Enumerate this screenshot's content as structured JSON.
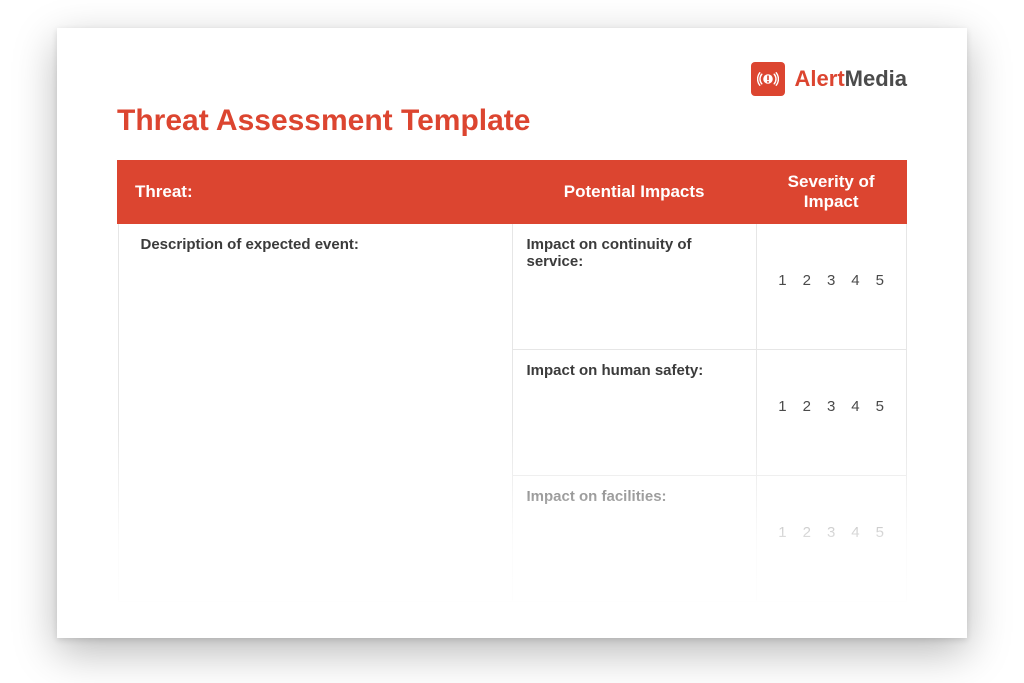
{
  "brand": {
    "alert": "Alert",
    "media": "Media",
    "icon_name": "alert-icon"
  },
  "title": "Threat Assessment Template",
  "headers": {
    "threat": "Threat:",
    "impacts": "Potential Impacts",
    "severity": "Severity of Impact"
  },
  "rows": {
    "description_label": "Description of expected event:",
    "impact_continuity": "Impact on continuity of service:",
    "impact_safety": "Impact on human safety:",
    "impact_facilities": "Impact on facilities:"
  },
  "rating_values": [
    "1",
    "2",
    "3",
    "4",
    "5"
  ]
}
